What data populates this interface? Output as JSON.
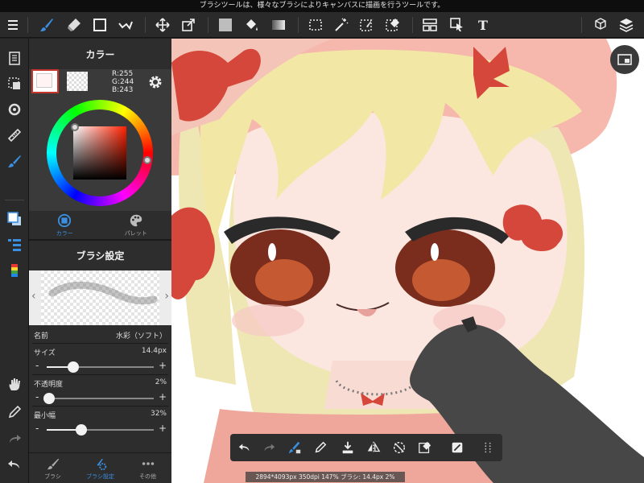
{
  "hint_text": "ブラシツールは、様々なブラシによりキャンバスに描画を行うツールです。",
  "colors": {
    "accent": "#3b8fe0",
    "main_color": "#fff4f3",
    "selection_border": "#c8372d"
  },
  "toolbar": {
    "items": [
      "menu-icon",
      "brush-icon",
      "eraser-icon",
      "shape-icon",
      "correction-icon",
      "move-icon",
      "transform-icon",
      "fill-color-icon",
      "bucket-icon",
      "gradient-icon",
      "select-icon",
      "magic-wand-icon",
      "select-pen-icon",
      "select-eraser-icon",
      "layout-icon",
      "operation-icon",
      "text-icon",
      "3d-icon",
      "layers-icon"
    ],
    "text_tool_glyph": "T"
  },
  "color_panel": {
    "title": "カラー",
    "r": "R:255",
    "g": "G:244",
    "b": "B:243",
    "tab_color": "カラー",
    "tab_palette": "パレット"
  },
  "brush_settings": {
    "title": "ブラシ設定",
    "name_label": "名前",
    "name_value": "水彩（ソフト）",
    "size_label": "サイズ",
    "size_value": "14.4px",
    "size_level": 0.25,
    "opacity_label": "不透明度",
    "opacity_value": "2%",
    "opacity_level": 0.02,
    "min_width_label": "最小幅",
    "min_width_value": "32%",
    "min_width_level": 0.32,
    "minus": "-",
    "plus": "+",
    "prev": "‹",
    "next": "›"
  },
  "bottom_tabs": {
    "brush": "ブラシ",
    "brush_settings": "ブラシ設定",
    "other": "その他"
  },
  "status_text": "2894*4093px 350dpi 147% ブラシ: 14.4px 2%"
}
